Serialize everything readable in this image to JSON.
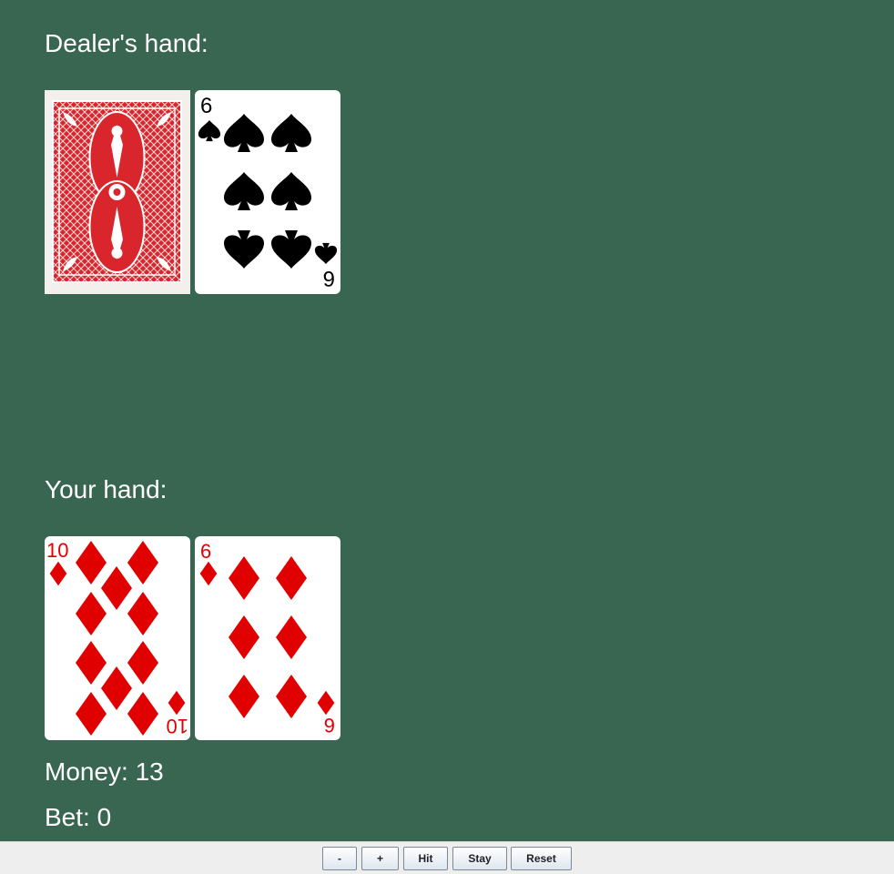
{
  "dealer": {
    "heading": "Dealer's hand:",
    "cards": [
      {
        "face_down": true
      },
      {
        "rank": "6",
        "suit": "spades",
        "color": "#000000"
      }
    ]
  },
  "player": {
    "heading": "Your hand:",
    "cards": [
      {
        "rank": "10",
        "suit": "diamonds",
        "color": "#e00000"
      },
      {
        "rank": "6",
        "suit": "diamonds",
        "color": "#e00000"
      }
    ]
  },
  "status": {
    "money": "Money: 13",
    "bet": "Bet: 0"
  },
  "controls": {
    "minus": "-",
    "plus": "+",
    "hit": "Hit",
    "stay": "Stay",
    "reset": "Reset"
  },
  "colors": {
    "felt": "#386650",
    "card_back": "#d8262c"
  }
}
